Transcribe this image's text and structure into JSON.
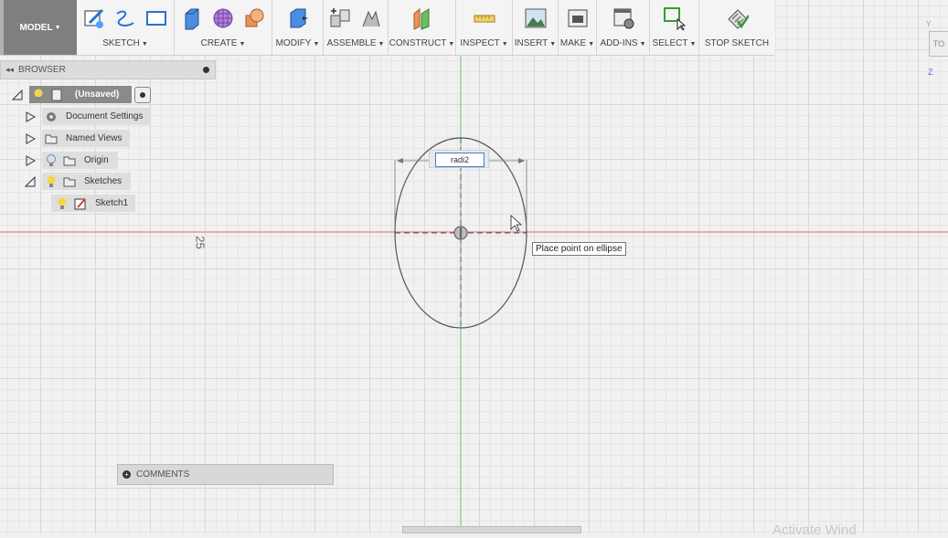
{
  "toolbar": {
    "mode": "MODEL",
    "groups": [
      {
        "label": "SKETCH",
        "icons": [
          "create-sketch-icon",
          "spline-icon",
          "rectangle-icon"
        ]
      },
      {
        "label": "CREATE",
        "icons": [
          "extrude-box-icon",
          "sphere-grid-icon",
          "combine-icon"
        ]
      },
      {
        "label": "MODIFY",
        "icons": [
          "press-pull-icon"
        ]
      },
      {
        "label": "ASSEMBLE",
        "icons": [
          "new-component-icon",
          "joint-icon"
        ]
      },
      {
        "label": "CONSTRUCT",
        "icons": [
          "offset-plane-icon"
        ]
      },
      {
        "label": "INSPECT",
        "icons": [
          "measure-icon"
        ]
      },
      {
        "label": "INSERT",
        "icons": [
          "insert-image-icon"
        ]
      },
      {
        "label": "MAKE",
        "icons": [
          "3d-print-icon"
        ]
      },
      {
        "label": "ADD-INS",
        "icons": [
          "scripts-icon"
        ]
      },
      {
        "label": "SELECT",
        "icons": [
          "select-arrow-icon"
        ]
      },
      {
        "label": "STOP SKETCH",
        "icons": [
          "stop-sketch-icon"
        ]
      }
    ]
  },
  "browser": {
    "title": "BROWSER",
    "items": [
      {
        "label": "(Unsaved)",
        "icons": [
          "lightbulb-icon",
          "document-icon"
        ]
      },
      {
        "label": "Document Settings",
        "icons": [
          "gear-icon"
        ]
      },
      {
        "label": "Named Views",
        "icons": [
          "folder-icon"
        ]
      },
      {
        "label": "Origin",
        "icons": [
          "lightbulb-icon",
          "folder-icon"
        ]
      },
      {
        "label": "Sketches",
        "icons": [
          "lightbulb-icon",
          "folder-icon"
        ]
      },
      {
        "label": "Sketch1",
        "icons": [
          "lightbulb-icon",
          "sketch-icon"
        ]
      }
    ]
  },
  "canvas": {
    "axis_label": "25",
    "dimension_input": "radi2",
    "tooltip": "Place point on ellipse"
  },
  "comments": {
    "label": "COMMENTS"
  },
  "viewcube": {
    "top": "TO",
    "y_axis": "Y",
    "z_axis": "Z"
  },
  "watermark": "Activate Wind",
  "colors": {
    "x_axis": "#e06666",
    "y_axis": "#6cc36c",
    "accent": "#3b7bd6",
    "mode_bg": "#7f7f7f"
  }
}
